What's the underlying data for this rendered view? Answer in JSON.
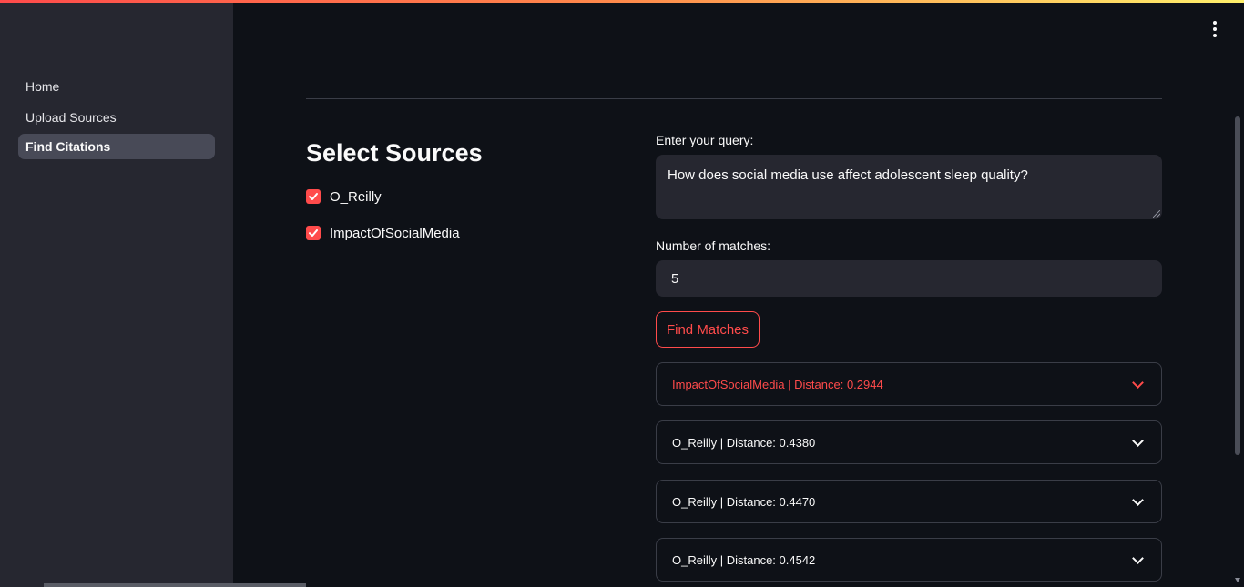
{
  "sidebar": {
    "items": [
      {
        "label": "Home",
        "active": false
      },
      {
        "label": "Upload Sources",
        "active": false
      },
      {
        "label": "Find Citations",
        "active": true
      }
    ]
  },
  "main": {
    "title": "Select Sources",
    "sources": [
      {
        "label": "O_Reilly",
        "checked": true
      },
      {
        "label": "ImpactOfSocialMedia",
        "checked": true
      }
    ],
    "query": {
      "label": "Enter your query:",
      "value": "How does social media use affect adolescent sleep quality?"
    },
    "matches": {
      "label": "Number of matches:",
      "value": "5"
    },
    "find_button_label": "Find Matches",
    "results": [
      {
        "label": "ImpactOfSocialMedia | Distance: 0.2944",
        "highlighted": true
      },
      {
        "label": "O_Reilly | Distance: 0.4380",
        "highlighted": false
      },
      {
        "label": "O_Reilly | Distance: 0.4470",
        "highlighted": false
      },
      {
        "label": "O_Reilly | Distance: 0.4542",
        "highlighted": false
      }
    ]
  },
  "colors": {
    "accent": "#ff4b4b",
    "background": "#0e1117",
    "sidebar": "#262730",
    "input": "#262730"
  },
  "icons": {
    "menu": "vertical-ellipsis-icon",
    "checkbox": "checkmark-icon",
    "expander": "chevron-down-icon"
  }
}
